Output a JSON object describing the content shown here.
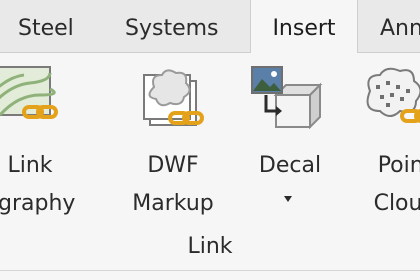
{
  "tabs": [
    {
      "label": "Steel"
    },
    {
      "label": "Systems"
    },
    {
      "label": "Insert",
      "active": true
    },
    {
      "label": "Ann"
    }
  ],
  "panel": {
    "group_label": "Link",
    "buttons": [
      {
        "line1": "Link",
        "line2": "ography",
        "icon": "link-topography-icon"
      },
      {
        "line1": "DWF",
        "line2": "Markup",
        "icon": "dwf-markup-icon"
      },
      {
        "line1": "Decal",
        "line2": "",
        "icon": "decal-icon",
        "dropdown": true
      },
      {
        "line1": "Point",
        "line2": "Cloud",
        "icon": "point-cloud-icon"
      }
    ]
  },
  "colors": {
    "ribbon_bg": "#f6f6f6",
    "tabbar_bg": "#e9e9e9",
    "chain_gold": "#e3a21a",
    "topo_green": "#8fb27a"
  }
}
